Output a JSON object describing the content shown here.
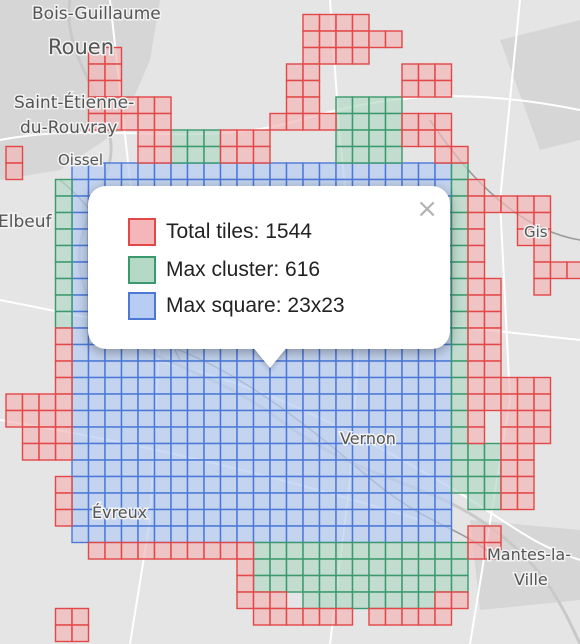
{
  "map": {
    "places": [
      {
        "name": "Bois-Guillaume"
      },
      {
        "name": "Rouen"
      },
      {
        "name": "Saint-Étienne-"
      },
      {
        "name": "du-Rouvray"
      },
      {
        "name": "Oissel"
      },
      {
        "name": "Elbeuf"
      },
      {
        "name": "Gis"
      },
      {
        "name": "Vernon"
      },
      {
        "name": "Évreux"
      },
      {
        "name": "Mantes-la-"
      },
      {
        "name": "Ville"
      }
    ],
    "tile_colors": {
      "total": {
        "fill": "#f4b6b8",
        "stroke": "#e24848"
      },
      "cluster": {
        "fill": "#b4d9c6",
        "stroke": "#3a9a6d"
      },
      "square": {
        "fill": "#b7cdf3",
        "stroke": "#4d78d8"
      }
    }
  },
  "popup": {
    "close_label": "×",
    "stats": [
      {
        "label": "Total tiles: 1544",
        "swatch_fill": "#f4b6b8",
        "swatch_stroke": "#e24848"
      },
      {
        "label": "Max cluster: 616",
        "swatch_fill": "#b4d9c6",
        "swatch_stroke": "#3a9a6d"
      },
      {
        "label": "Max square: 23x23",
        "swatch_fill": "#b7cdf3",
        "swatch_stroke": "#4d78d8"
      }
    ]
  }
}
